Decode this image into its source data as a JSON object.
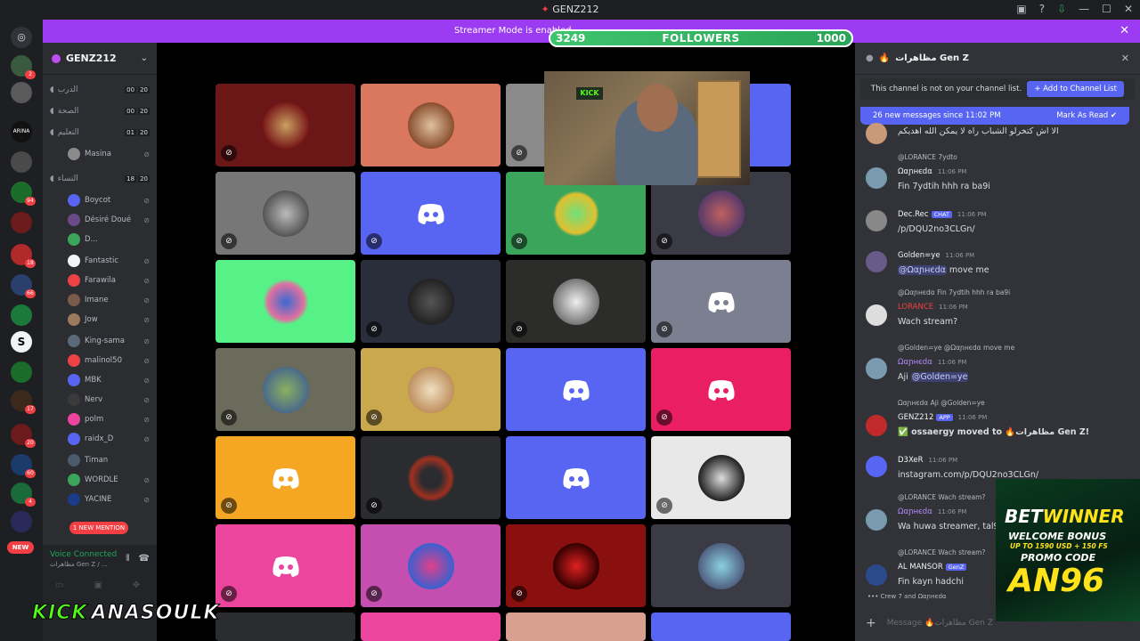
{
  "titlebar": {
    "title": "GENZ212"
  },
  "streamer_mode": {
    "text": "Streamer Mode is enabled"
  },
  "followers": {
    "current": "3249",
    "label": "FOLLOWERS",
    "goal": "1000"
  },
  "servers": {
    "new_label": "NEW"
  },
  "guild": {
    "name": "GENZ212"
  },
  "voice_channels": [
    {
      "name": "الدرب",
      "counts": [
        "00",
        "20"
      ]
    },
    {
      "name": "الصحة",
      "counts": [
        "00",
        "20"
      ]
    },
    {
      "name": "التعليم",
      "counts": [
        "01",
        "20"
      ]
    },
    {
      "name": "النساء",
      "counts": [
        "18",
        "20"
      ]
    }
  ],
  "members": [
    "Masina",
    "Boycot",
    "Désiré Doué",
    "D...",
    "Fantastic",
    "Farawila",
    "Imane",
    "Jow",
    "King-sama",
    "malinol50",
    "MBK",
    "Nerv",
    "polm",
    "raidx_D",
    "Timan",
    "WORDLE",
    "YACINE"
  ],
  "mention_pill": "1 NEW MENTION",
  "voice_panel": {
    "title": "Voice Connected",
    "subtitle": "مظاهرات Gen Z / ..."
  },
  "overlay": {
    "brand": "KICK",
    "handle": "ANASOULK"
  },
  "chat": {
    "channel_name": "مظاهرات Gen Z",
    "not_on_list": "This channel is not on your channel list.",
    "add_button": "Add to Channel List",
    "new_messages": "26 new messages since 11:02 PM",
    "mark_as_read": "Mark As Read",
    "messages": [
      {
        "body": "الا اش كتخرلو الشباب راه لا يمكن الله اهديكم"
      },
      {
        "reply": "@LORANCE 7ydto",
        "name": "Ωαɲнєdα",
        "time": "11:06 PM",
        "body": "Fin 7ydtih hhh ra ba9i"
      },
      {
        "name": "Dec.Rec",
        "tag": "CHAT",
        "time": "11:06 PM",
        "body": "/p/DQU2no3CLGn/"
      },
      {
        "name": "Golden=ye",
        "time": "11:06 PM",
        "mention": "@Ωαɲнєdα",
        "body": "move me"
      },
      {
        "reply": "@Ωαɲнєdα Fin 7ydtih hhh ra ba9i",
        "name": "LORANCE",
        "time": "11:06 PM",
        "body": "Wach stream?"
      },
      {
        "reply": "@Golden=ye @Ωαɲнєdα move me",
        "name": "Ωαɲнєdα",
        "time": "11:06 PM",
        "body": "Aji",
        "mention": "@Golden=ye"
      },
      {
        "reply": "Ωαɲнєdα Aji @Golden=ye",
        "name": "GENZ212",
        "tag": "APP",
        "time": "11:06 PM",
        "body": "✅ ossaergy moved to 🔥مظاهرات Gen Z!"
      },
      {
        "name": "D3XeR",
        "time": "11:06 PM",
        "body": "instagram.com/p/DQU2no3CLGn/"
      },
      {
        "reply": "@LORANCE Wach stream?",
        "name": "Ωαɲнєdα",
        "time": "11:06 PM",
        "body": "Wa huwa streamer, tal9"
      },
      {
        "reply": "@LORANCE Wach stream?",
        "name": "AL MANSOR",
        "tag": "GenZ",
        "body": "Fin kayn hadchi"
      }
    ],
    "typing": "Crew 7 and Ωαɲнєdα",
    "composer_placeholder": "Message 🔥مظاهرات Gen Z"
  },
  "ad": {
    "brand_a": "BET",
    "brand_b": "WINNER",
    "line2": "WELCOME BONUS",
    "line3": "UP TO 1590 USD + 150 FS",
    "line4": "PROMO CODE",
    "code": "AN96"
  },
  "colors": {
    "accent": "#5865f2",
    "streamer_bar": "#9b3bf2",
    "kick_green": "#53fc18"
  }
}
